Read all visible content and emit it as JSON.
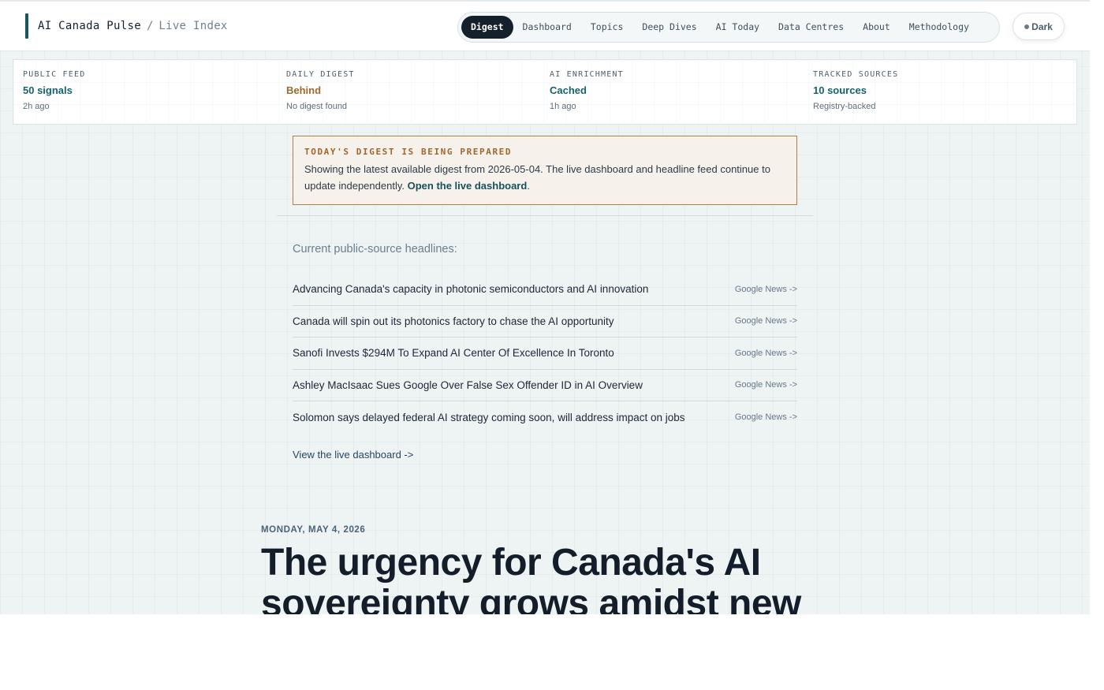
{
  "brand": {
    "title": "AI Canada Pulse",
    "separator": "/",
    "subtitle": "Live Index"
  },
  "nav": {
    "items": [
      {
        "label": "Digest",
        "active": true
      },
      {
        "label": "Dashboard",
        "active": false
      },
      {
        "label": "Topics",
        "active": false
      },
      {
        "label": "Deep Dives",
        "active": false
      },
      {
        "label": "AI Today",
        "active": false
      },
      {
        "label": "Data Centres",
        "active": false
      },
      {
        "label": "About",
        "active": false
      },
      {
        "label": "Methodology",
        "active": false
      }
    ]
  },
  "theme_toggle": {
    "label": "Dark",
    "icon": "dot-icon"
  },
  "status": [
    {
      "label": "PUBLIC FEED",
      "value": "50 signals",
      "note": "2h ago",
      "tone": "teal"
    },
    {
      "label": "DAILY DIGEST",
      "value": "Behind",
      "note": "No digest found",
      "tone": "amber"
    },
    {
      "label": "AI ENRICHMENT",
      "value": "Cached",
      "note": "1h ago",
      "tone": "teal"
    },
    {
      "label": "TRACKED SOURCES",
      "value": "10 sources",
      "note": "Registry-backed",
      "tone": "teal"
    }
  ],
  "notice": {
    "title": "TODAY'S DIGEST IS BEING PREPARED",
    "text": "Showing the latest available digest from 2026-05-04. The live dashboard and headline feed continue to update independently.",
    "link": "Open the live dashboard",
    "trailing": "."
  },
  "headlines": {
    "title": "Current public-source headlines:",
    "items": [
      {
        "title": "Advancing Canada's capacity in photonic semiconductors and AI innovation",
        "source": "Google News ->"
      },
      {
        "title": "Canada will spin out its photonics factory to chase the AI opportunity",
        "source": "Google News ->"
      },
      {
        "title": "Sanofi Invests $294M To Expand AI Center Of Excellence In Toronto",
        "source": "Google News ->"
      },
      {
        "title": "Ashley MacIsaac Sues Google Over False Sex Offender ID in AI Overview",
        "source": "Google News ->"
      },
      {
        "title": "Solomon says delayed federal AI strategy coming soon, will address impact on jobs",
        "source": "Google News ->"
      }
    ],
    "view_live": "View the live dashboard ->"
  },
  "digest": {
    "date": "MONDAY, MAY 4, 2026",
    "headline": "The urgency for Canada's AI sovereignty grows amidst new"
  }
}
